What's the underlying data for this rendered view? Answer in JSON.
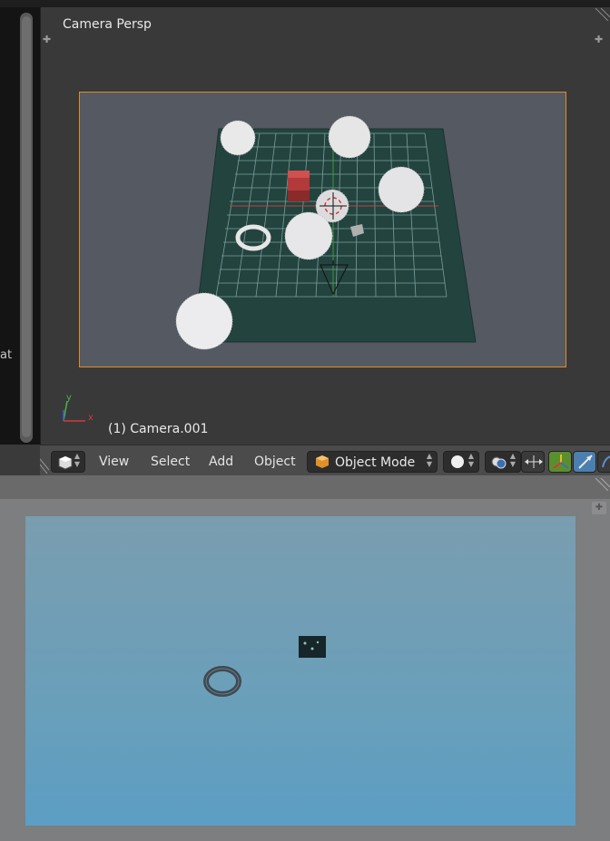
{
  "left_panel": {
    "partial_text": "at"
  },
  "viewport": {
    "title": "Camera Persp",
    "object_label": "(1) Camera.001",
    "axis_x": "x",
    "axis_y": "y"
  },
  "header": {
    "menu": [
      "View",
      "Select",
      "Add",
      "Object"
    ],
    "mode": "Object Mode",
    "icons": [
      "editor-type-icon",
      "mode-cube-icon",
      "shading-sphere-icon",
      "overlay-icon",
      "manipulator-icon",
      "translate-icon",
      "rotate-icon"
    ]
  },
  "colors": {
    "camera_frame": "#e08a2a",
    "grid_plane": "#23433f",
    "cube": "#b33a3a",
    "render_bg": "#6a9fba"
  }
}
